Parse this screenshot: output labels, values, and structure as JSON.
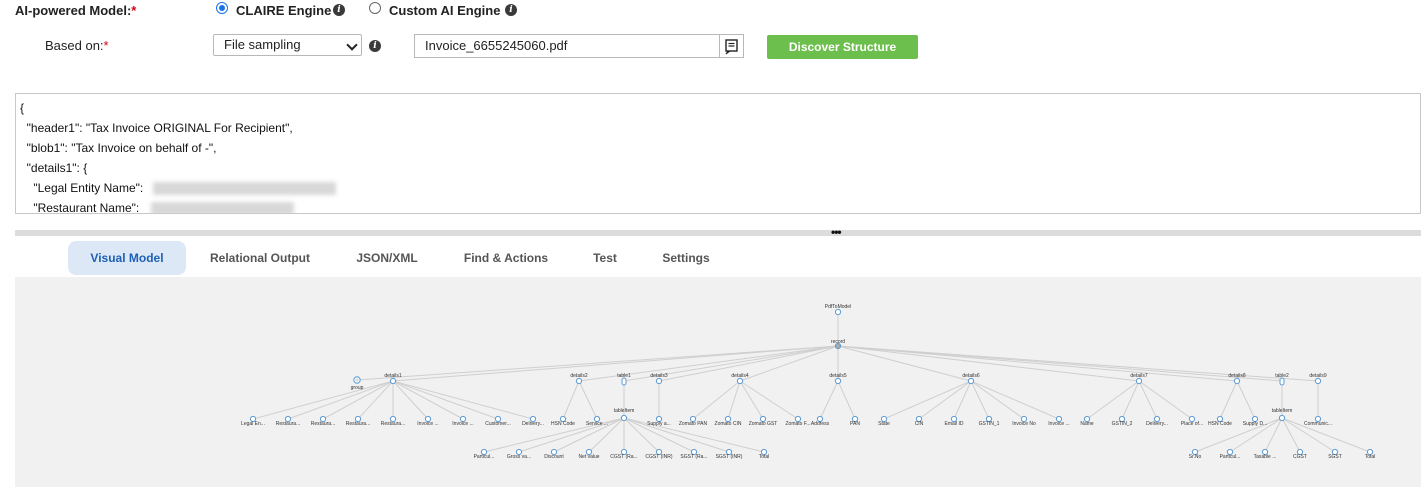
{
  "form": {
    "ai_model_label": "AI-powered Model:",
    "required_mark": "*",
    "engine_options": [
      "CLAIRE Engine",
      "Custom AI Engine"
    ],
    "selected_engine": "CLAIRE Engine",
    "based_on_label": "Based on:",
    "based_on_value": "File sampling",
    "file_value": "Invoice_6655245060.pdf",
    "discover_button": "Discover Structure",
    "info_glyph": "i"
  },
  "json_preview": {
    "lines": [
      "{",
      "  \"header1\": \"Tax Invoice ORIGINAL For Recipient\",",
      "  \"blob1\": \"Tax Invoice on behalf of -\",",
      "  \"details1\": {",
      "    \"Legal Entity Name\": ",
      "    \"Restaurant Name\": "
    ]
  },
  "splitter": "•••",
  "tabs": [
    "Visual Model",
    "Relational Output",
    "JSON/XML",
    "Find & Actions",
    "Test",
    "Settings"
  ],
  "active_tab": "Visual Model",
  "tree": {
    "root": "PdfToModel",
    "record": "record",
    "group": "group",
    "sections": [
      "details1",
      "details2",
      "table1",
      "details3",
      "details4",
      "details5",
      "details6",
      "details7",
      "details8",
      "table2",
      "details9"
    ],
    "table_item": "tableItem",
    "leaves": {
      "details1": [
        "Legal En...",
        "Restaura...",
        "Restaura...",
        "Restaura...",
        "Restaura...",
        "Invoice ...",
        "Invoice ...",
        "Customer...",
        "Delivery..."
      ],
      "details2": [
        "HSN Code",
        "Service ..."
      ],
      "details3": [
        "Supply a..."
      ],
      "details4": [
        "Zomato PAN",
        "Zomato CIN",
        "Zomato GST",
        "Zomato F..."
      ],
      "details5": [
        "Address",
        "PAN"
      ],
      "details6": [
        "State",
        "CIN",
        "Email ID",
        "GSTIN_1",
        "Invoice No",
        "Invoice ..."
      ],
      "details7": [
        "Name",
        "GSTIN_2",
        "Delivery...",
        "Place of..."
      ],
      "details8": [
        "HSN Code",
        "Supply D..."
      ],
      "details9": [
        "Communic..."
      ],
      "table1": [
        "Particul...",
        "Gross va...",
        "Discount",
        "Net value",
        "CGST (Ra...",
        "CGST (INR)",
        "SGST (Ra...",
        "SGST (INR)",
        "Total"
      ],
      "table2": [
        "Sr.No",
        "Particul...",
        "Taxable ...",
        "CGST",
        "SGST",
        "Total"
      ]
    }
  },
  "colors": {
    "accent": "#1a73e8",
    "green_button": "#6cbf4c",
    "required": "#d0021b",
    "tab_active_bg": "#dde8f7",
    "tree_node": "#5b9bd5"
  }
}
